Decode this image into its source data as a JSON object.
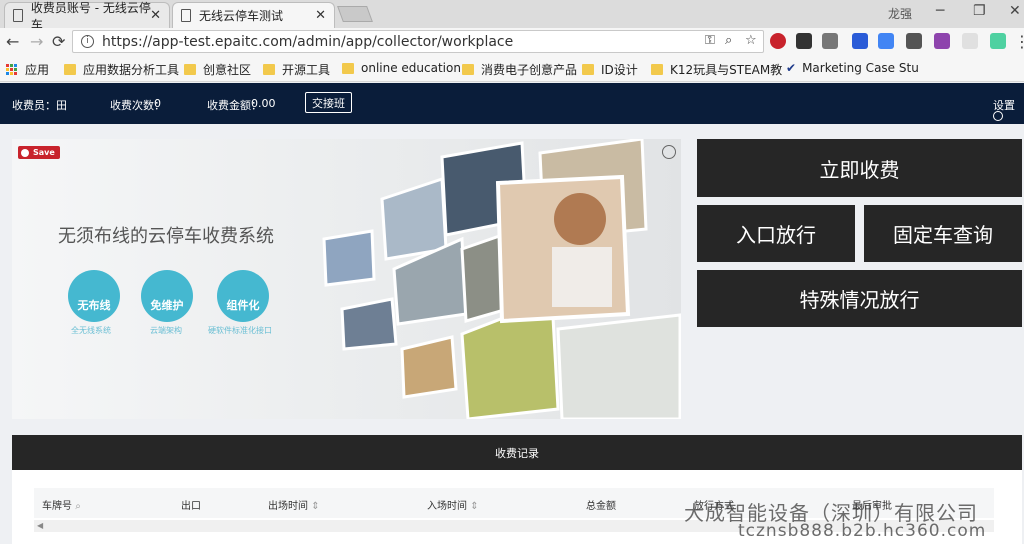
{
  "browser": {
    "tabs": [
      {
        "title": "收费员账号 - 无线云停车"
      },
      {
        "title": "无线云停车测试"
      }
    ],
    "user_label": "龙强",
    "url": "https://app-test.epaitc.com/admin/app/collector/workplace",
    "bookmarks": [
      "应用",
      "应用数据分析工具",
      "创意社区",
      "开源工具",
      "online education",
      "消费电子创意产品",
      "ID设计",
      "K12玩具与STEAM教",
      "Marketing Case Stu"
    ]
  },
  "topbar": {
    "collector": "收费员：田",
    "count": "收费次数：",
    "count_value": "0",
    "amount": "收费金额：",
    "amount_value": "0.00",
    "shift_button": "交接班",
    "settings": "设置"
  },
  "banner": {
    "save": "Save",
    "title": "无须布线的云停车收费系统",
    "features": [
      {
        "label": "无布线",
        "caption": "全无线系统"
      },
      {
        "label": "免维护",
        "caption": "云端架构"
      },
      {
        "label": "组件化",
        "caption": "硬软件标准化接口"
      }
    ]
  },
  "actions": {
    "charge_now": "立即收费",
    "entry_release": "入口放行",
    "fixed_car_query": "固定车查询",
    "special_release": "特殊情况放行"
  },
  "records": {
    "title": "收费记录",
    "columns": [
      "车牌号",
      "出口",
      "出场时间",
      "入场时间",
      "总金额",
      "放行方式",
      "最后审批"
    ]
  },
  "watermark": {
    "line1": "大成智能设备（深圳）有限公司",
    "line2": "tcznsb888.b2b.hc360.com"
  },
  "colors": {
    "topbar": "#0a1d3a",
    "action_bg": "#262626",
    "feature_circle": "#45b8d0",
    "save_badge": "#c8232c"
  }
}
